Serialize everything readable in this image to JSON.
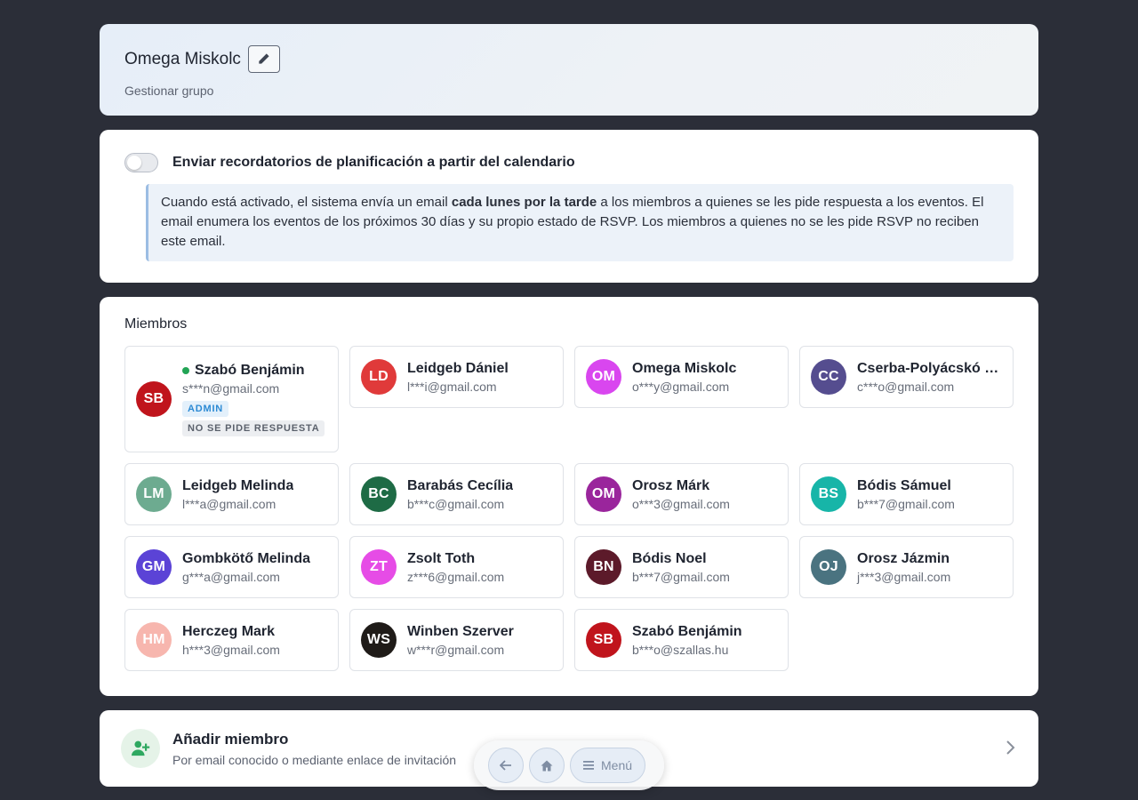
{
  "header": {
    "title": "Omega Miskolc",
    "subtitle": "Gestionar grupo"
  },
  "reminder": {
    "toggle_label": "Enviar recordatorios de planificación a partir del calendario",
    "toggle_on": false,
    "info_pre": "Cuando está activado, el sistema envía un email ",
    "info_bold": "cada lunes por la tarde",
    "info_post": " a los miembros a quienes se les pide respuesta a los eventos. El email enumera los eventos de los próximos 30 días y su propio estado de RSVP. Los miembros a quienes no se les pide RSVP no reciben este email."
  },
  "members": {
    "title": "Miembros",
    "list": [
      {
        "initials": "SB",
        "name": "Szabó Benjámin",
        "email": "s***n@gmail.com",
        "color": "#c0141c",
        "online": true,
        "badges": [
          "ADMIN",
          "NO SE PIDE RESPUESTA"
        ]
      },
      {
        "initials": "LD",
        "name": "Leidgeb Dániel",
        "email": "l***i@gmail.com",
        "color": "#e03a3a"
      },
      {
        "initials": "OM",
        "name": "Omega Miskolc",
        "email": "o***y@gmail.com",
        "color": "#d946ef"
      },
      {
        "initials": "CC",
        "name": "Cserba-Polyácskó Csaba",
        "email": "c***o@gmail.com",
        "color": "#554d8f"
      },
      {
        "initials": "LM",
        "name": "Leidgeb Melinda",
        "email": "l***a@gmail.com",
        "color": "#6dab90"
      },
      {
        "initials": "BC",
        "name": "Barabás Cecília",
        "email": "b***c@gmail.com",
        "color": "#1e6b45"
      },
      {
        "initials": "OM",
        "name": "Orosz Márk",
        "email": "o***3@gmail.com",
        "color": "#9a259c"
      },
      {
        "initials": "BS",
        "name": "Bódis Sámuel",
        "email": "b***7@gmail.com",
        "color": "#17b5a8"
      },
      {
        "initials": "GM",
        "name": "Gombkötő Melinda",
        "email": "g***a@gmail.com",
        "color": "#5b43d6"
      },
      {
        "initials": "ZT",
        "name": "Zsolt Toth",
        "email": "z***6@gmail.com",
        "color": "#e64ce6"
      },
      {
        "initials": "BN",
        "name": "Bódis Noel",
        "email": "b***7@gmail.com",
        "color": "#5c1a2a"
      },
      {
        "initials": "OJ",
        "name": "Orosz Jázmin",
        "email": "j***3@gmail.com",
        "color": "#4a7380"
      },
      {
        "initials": "HM",
        "name": "Herczeg Mark",
        "email": "h***3@gmail.com",
        "color": "#f7b6ae"
      },
      {
        "initials": "WS",
        "name": "Winben Szerver",
        "email": "w***r@gmail.com",
        "color": "#1f1b18"
      },
      {
        "initials": "SB",
        "name": "Szabó Benjámin",
        "email": "b***o@szallas.hu",
        "color": "#c0141c"
      }
    ]
  },
  "add_member": {
    "title": "Añadir miembro",
    "subtitle": "Por email conocido o mediante enlace de invitación"
  },
  "nav": {
    "back_icon": "arrow-left-icon",
    "home_icon": "home-icon",
    "menu_label": "Menú"
  }
}
